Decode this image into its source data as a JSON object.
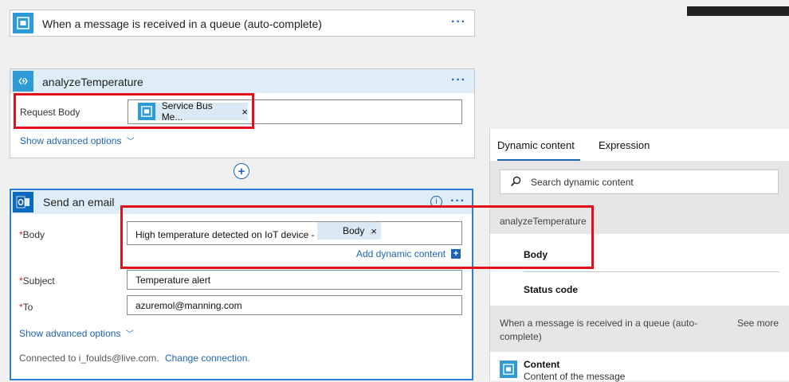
{
  "trigger": {
    "title": "When a message is received in a queue (auto-complete)",
    "more": "···"
  },
  "analyze": {
    "title": "analyzeTemperature",
    "more": "···",
    "request_body_label": "Request Body",
    "token_label": "Service Bus Me...",
    "token_close": "×",
    "advanced_label": "Show advanced options",
    "advanced_chevron": "﹀"
  },
  "add_step": "+",
  "email": {
    "title": "Send an email",
    "more": "···",
    "info": "i",
    "body_label": "Body",
    "body_text": "High temperature detected on IoT device -",
    "body_token": "Body",
    "body_token_close": "×",
    "add_dynamic": "Add dynamic content",
    "add_dynamic_icon": "+",
    "subject_label": "Subject",
    "subject_value": "Temperature alert",
    "to_label": "To",
    "to_value": "azuremol@manning.com",
    "required_mark": "*",
    "advanced_label": "Show advanced options",
    "advanced_chevron": "﹀",
    "connected_text": "Connected to i_foulds@live.com.",
    "change_connection": "Change connection."
  },
  "dynamic": {
    "tab_dynamic": "Dynamic content",
    "tab_expression": "Expression",
    "search_placeholder": "Search dynamic content",
    "group1": "analyzeTemperature",
    "item_body": "Body",
    "item_status": "Status code",
    "group2": "When a message is received in a queue (auto-complete)",
    "see_more": "See more",
    "content_title": "Content",
    "content_desc": "Content of the message"
  },
  "colors": {
    "accent_blue": "#1f64b4",
    "highlight_red": "#e2101b",
    "header_bg": "#deedf7",
    "icon_bg": "#2e9bd6",
    "outlook_blue": "#0b6abf"
  }
}
